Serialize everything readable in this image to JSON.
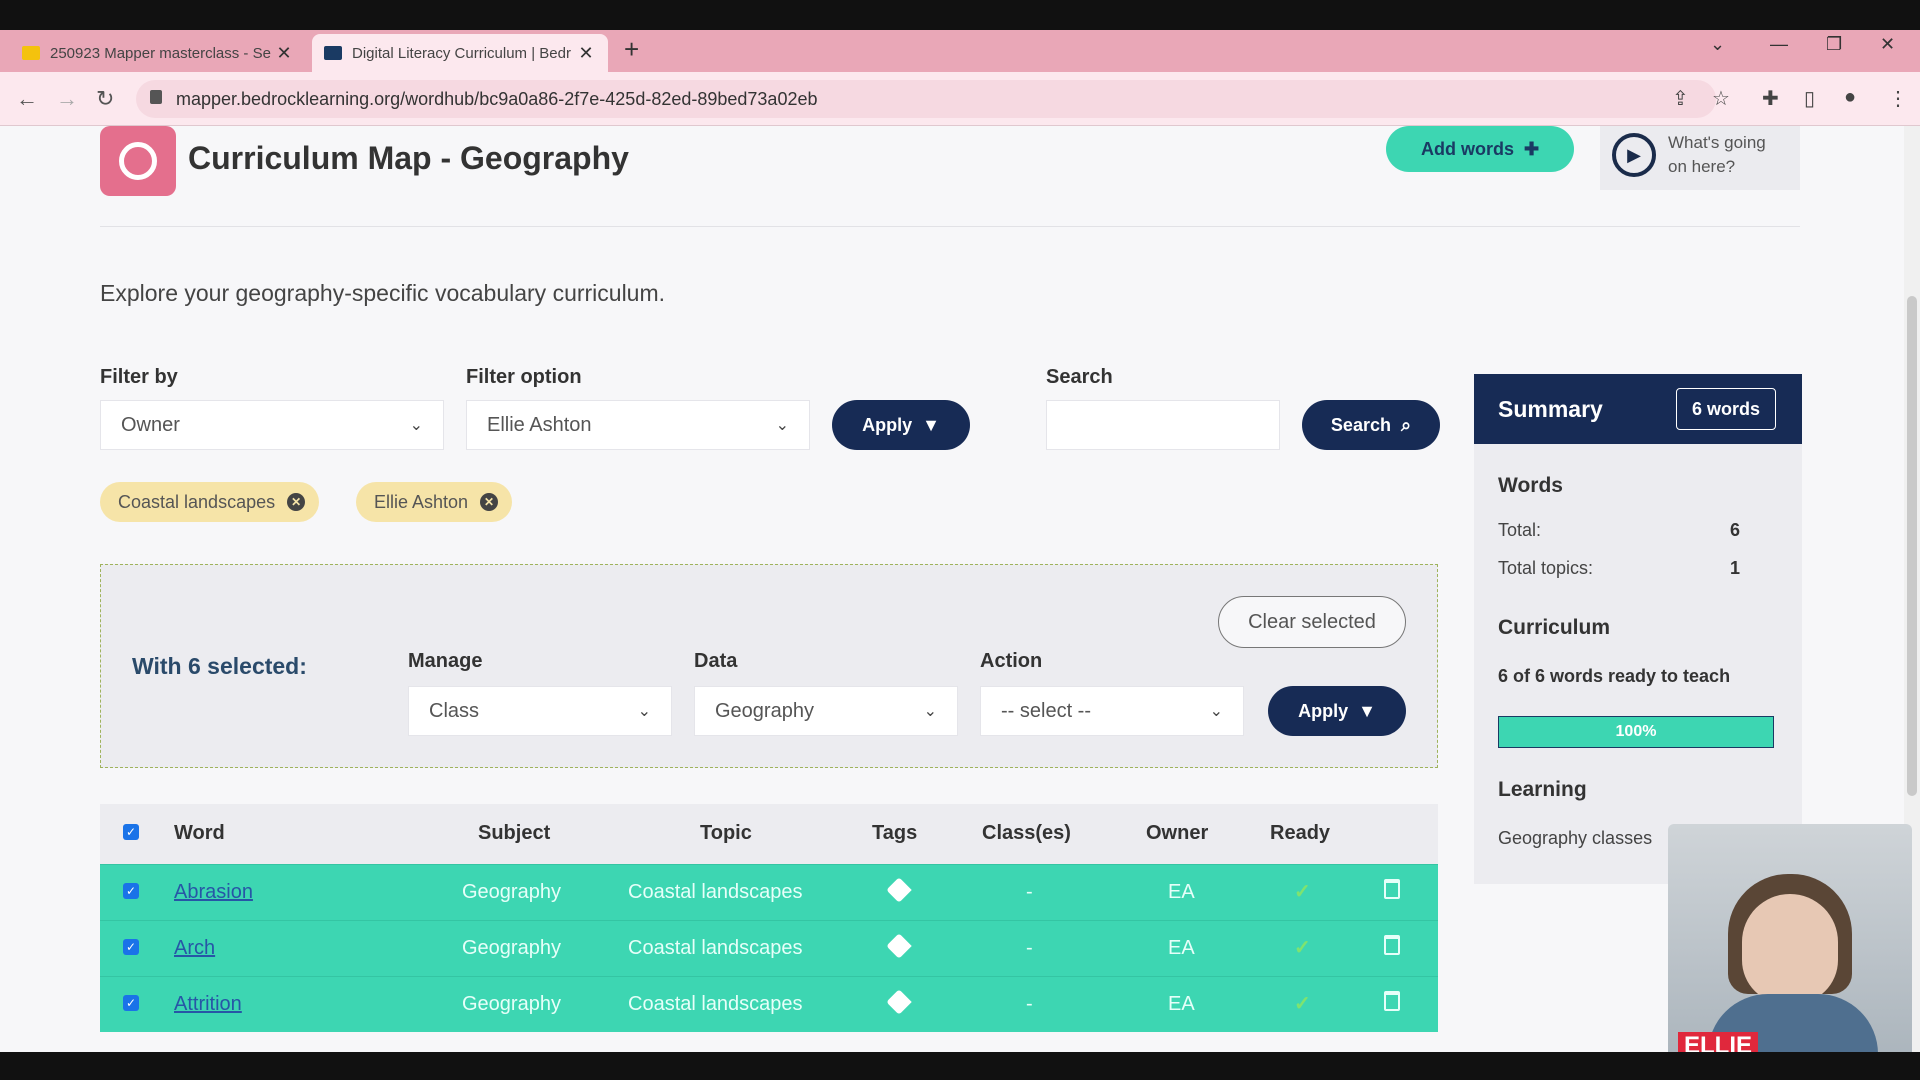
{
  "browser": {
    "tabs": [
      {
        "title": "250923 Mapper masterclass - Se",
        "active": false,
        "favicon_color": "#f4c20d"
      },
      {
        "title": "Digital Literacy Curriculum | Bedr",
        "active": true,
        "favicon_color": "#1a3a63"
      }
    ],
    "url": "mapper.bedrocklearning.org/wordhub/bc9a0a86-2f7e-425d-82ed-89bed73a02eb"
  },
  "header": {
    "title": "Curriculum Map - Geography",
    "add_words_label": "Add words",
    "help_label": "What's going on here?"
  },
  "intro": "Explore your geography-specific vocabulary curriculum.",
  "filters": {
    "filter_by_label": "Filter by",
    "filter_by_value": "Owner",
    "filter_option_label": "Filter option",
    "filter_option_value": "Ellie Ashton",
    "apply_label": "Apply",
    "search_label": "Search",
    "search_button_label": "Search",
    "chips": [
      "Coastal landscapes",
      "Ellie Ashton"
    ]
  },
  "bulk": {
    "selected_label": "With 6 selected:",
    "clear_label": "Clear selected",
    "manage_label": "Manage",
    "manage_value": "Class",
    "data_label": "Data",
    "data_value": "Geography",
    "action_label": "Action",
    "action_value": "-- select --",
    "apply_label": "Apply"
  },
  "summary": {
    "title": "Summary",
    "badge": "6 words",
    "words_heading": "Words",
    "total_label": "Total:",
    "total_value": "6",
    "topics_label": "Total topics:",
    "topics_value": "1",
    "curriculum_heading": "Curriculum",
    "ready_text": "6 of 6 words ready to teach",
    "progress_fraction": 1.0,
    "progress_text": "100%",
    "learning_heading": "Learning",
    "learning_text": "Geography classes"
  },
  "table": {
    "columns": [
      "Word",
      "Subject",
      "Topic",
      "Tags",
      "Class(es)",
      "Owner",
      "Ready"
    ],
    "rows": [
      {
        "word": "Abrasion",
        "subject": "Geography",
        "topic": "Coastal landscapes",
        "classes": "-",
        "owner": "EA"
      },
      {
        "word": "Arch",
        "subject": "Geography",
        "topic": "Coastal landscapes",
        "classes": "-",
        "owner": "EA"
      },
      {
        "word": "Attrition",
        "subject": "Geography",
        "topic": "Coastal landscapes",
        "classes": "-",
        "owner": "EA"
      }
    ]
  },
  "video": {
    "name": "ELLIE"
  },
  "colors": {
    "navy": "#172b55",
    "teal": "#3dd6b2",
    "chip": "#f6e4a8",
    "logo": "#e46f8d"
  }
}
